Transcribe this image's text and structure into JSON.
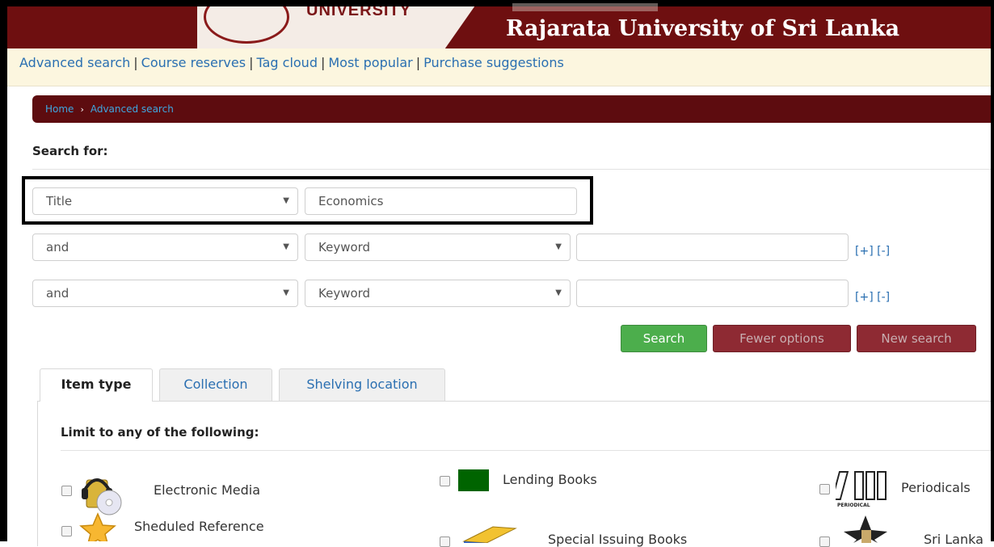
{
  "banner": {
    "logo_text": "UNIVERSITY",
    "title": "Rajarata University of Sri Lanka",
    "colors": {
      "maroon": "#6e0f10",
      "nav_bg": "#fcf6df",
      "link": "#2a6fb1"
    }
  },
  "topnav": {
    "items": [
      {
        "label": "Advanced search"
      },
      {
        "label": "Course reserves"
      },
      {
        "label": "Tag cloud"
      },
      {
        "label": "Most popular"
      },
      {
        "label": "Purchase suggestions"
      }
    ],
    "separator": "|"
  },
  "breadcrumb": {
    "home": "Home",
    "current": "Advanced search",
    "chevron": "›"
  },
  "search": {
    "heading": "Search for:",
    "rows": [
      {
        "index_field": "Title",
        "term": "Economics"
      },
      {
        "operator": "and",
        "index_field": "Keyword",
        "term": "",
        "plus": "[+]",
        "minus": "[-]"
      },
      {
        "operator": "and",
        "index_field": "Keyword",
        "term": "",
        "plus": "[+]",
        "minus": "[-]"
      }
    ],
    "caret": "▼"
  },
  "buttons": {
    "search": "Search",
    "fewer_options": "Fewer options",
    "new_search": "New search"
  },
  "tabs": [
    {
      "label": "Item type",
      "active": true
    },
    {
      "label": "Collection",
      "active": false
    },
    {
      "label": "Shelving location",
      "active": false
    }
  ],
  "limits": {
    "heading": "Limit to any of the following:",
    "item_types": [
      {
        "label": "Electronic Media",
        "icon": "cd-headphones-icon"
      },
      {
        "label": "Lending Books",
        "icon": "green-square-icon"
      },
      {
        "label": "Periodicals",
        "icon": "periodical-icon",
        "icon_caption": "PERIODICAL"
      },
      {
        "label": "Sheduled Reference",
        "icon": "star-icon"
      },
      {
        "label": "Special Issuing Books",
        "icon": "book-icon"
      },
      {
        "label": "Sri Lanka",
        "icon": "sri-lanka-icon"
      }
    ]
  }
}
